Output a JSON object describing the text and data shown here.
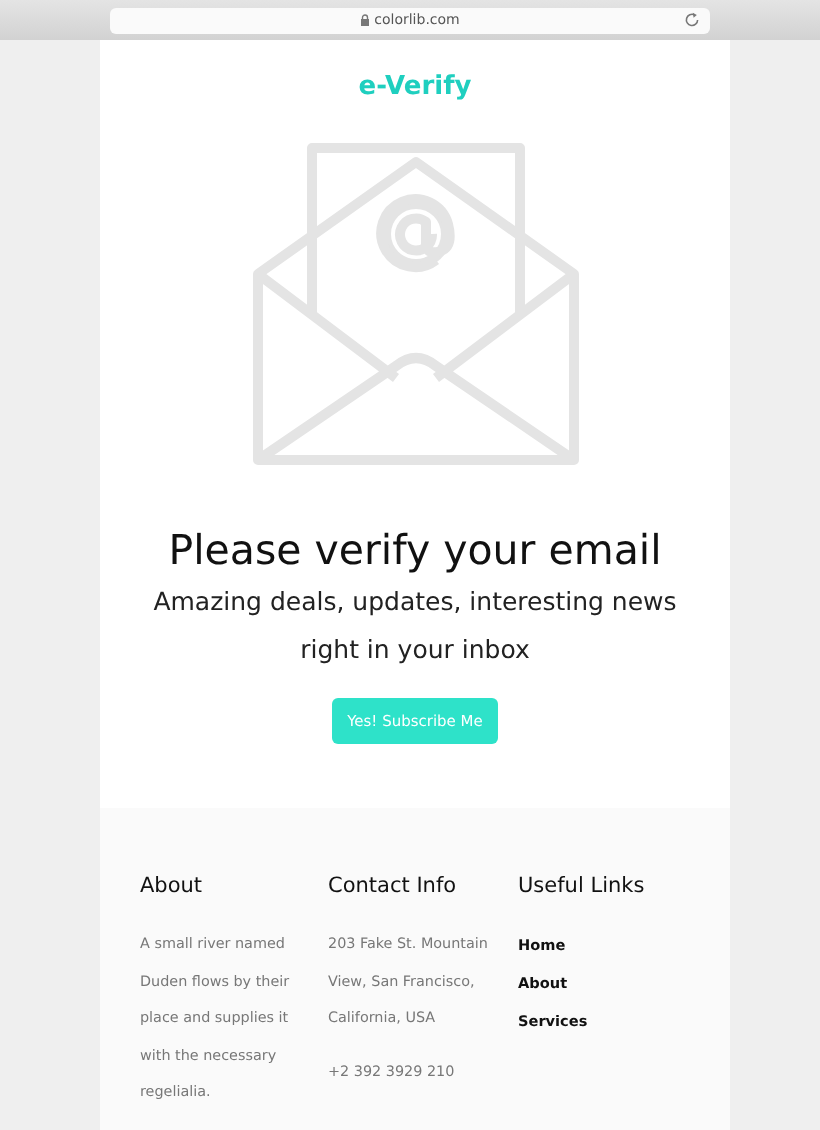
{
  "browser": {
    "url": "colorlib.com"
  },
  "logo": "e-Verify",
  "heading": "Please verify your email",
  "subtitle": "Amazing deals, updates, interesting news right in your inbox",
  "button": "Yes! Subscribe Me",
  "footer": {
    "about": {
      "title": "About",
      "text": "A small river named Duden flows by their place and supplies it with the necessary regelialia."
    },
    "contact": {
      "title": "Contact Info",
      "address": "203 Fake St. Mountain View, San Francisco, California, USA",
      "phone": "+2 392 3929 210"
    },
    "links": {
      "title": "Useful Links",
      "items": [
        "Home",
        "About",
        "Services"
      ]
    }
  }
}
